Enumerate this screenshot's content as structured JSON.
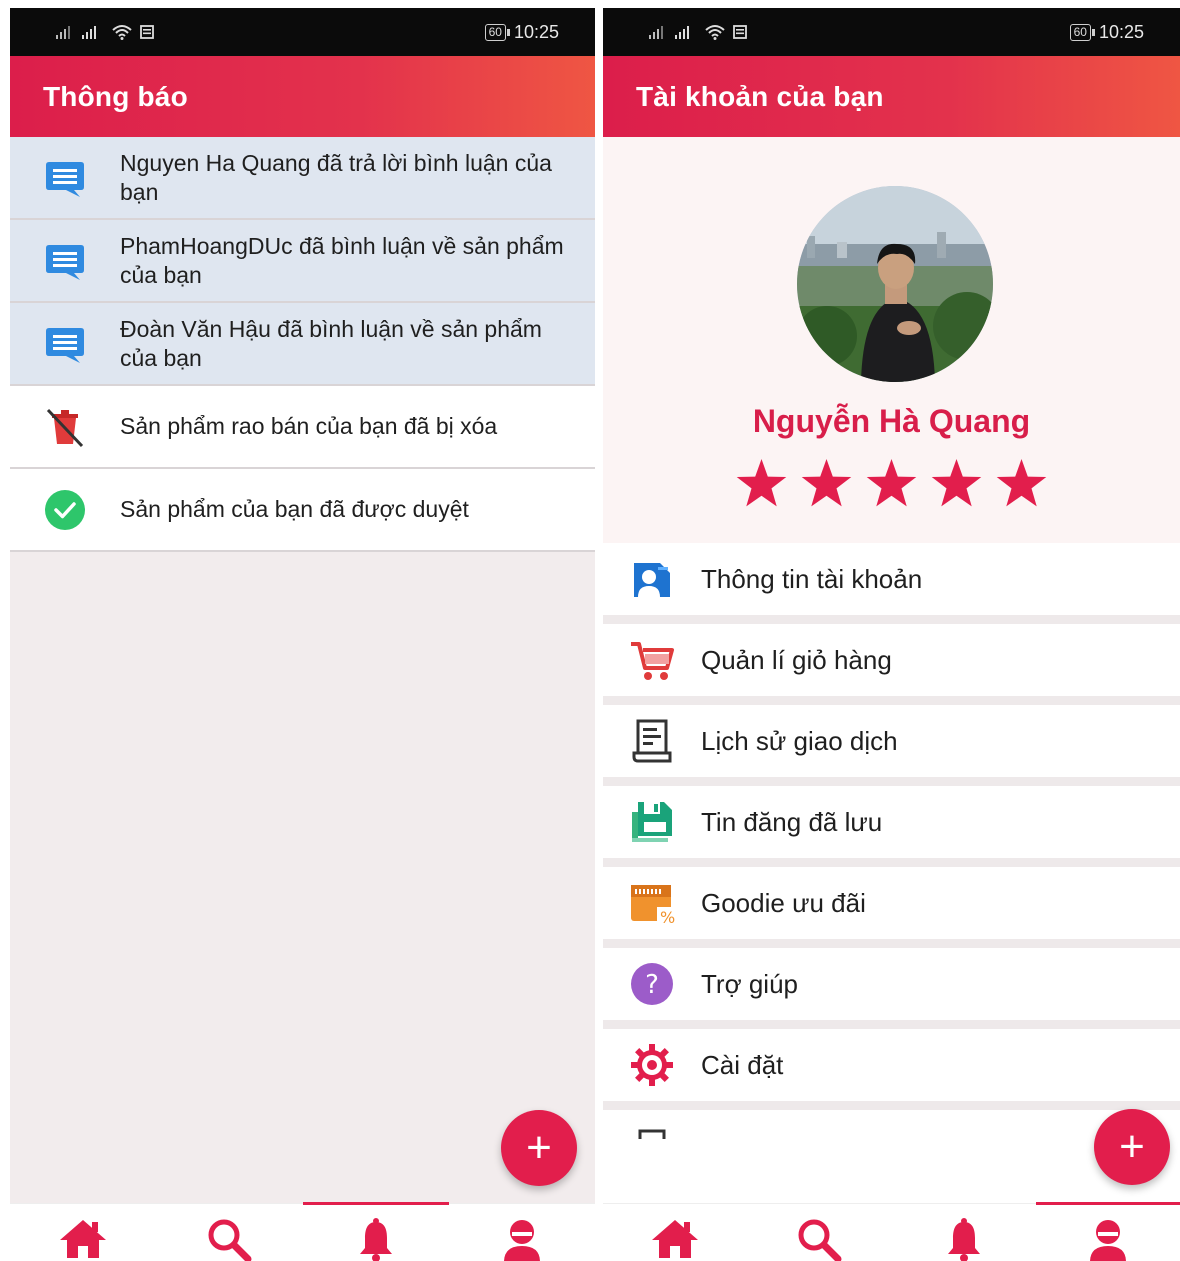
{
  "status_bar": {
    "battery": "60",
    "time": "10:25"
  },
  "left": {
    "title": "Thông báo",
    "notifications": [
      {
        "text": "Nguyen Ha Quang đã trả lời bình luận của bạn",
        "icon": "chat-icon",
        "read": false
      },
      {
        "text": "PhamHoangDUc đã bình luận về sản phẩm của bạn",
        "icon": "chat-icon",
        "read": false
      },
      {
        "text": "Đoàn Văn Hậu đã bình luận về sản phẩm của bạn",
        "icon": "chat-icon",
        "read": false
      },
      {
        "text": "Sản phẩm rao bán của bạn đã bị xóa",
        "icon": "deleted-icon",
        "read": true
      },
      {
        "text": "Sản phẩm của bạn đã được duyệt",
        "icon": "check-icon",
        "read": true
      }
    ],
    "fab": "+",
    "active_tab": "notifications"
  },
  "right": {
    "title": "Tài khoản của bạn",
    "profile": {
      "name": "Nguyễn Hà Quang",
      "rating": 5,
      "max_rating": 5
    },
    "menu": [
      {
        "label": "Thông tin tài khoản",
        "icon": "account-info-icon"
      },
      {
        "label": "Quản lí giỏ hàng",
        "icon": "cart-icon"
      },
      {
        "label": "Lịch sử giao dịch",
        "icon": "receipt-icon"
      },
      {
        "label": "Tin đăng đã lưu",
        "icon": "save-icon"
      },
      {
        "label": "Goodie ưu đãi",
        "icon": "voucher-icon"
      },
      {
        "label": "Trợ giúp",
        "icon": "help-icon"
      },
      {
        "label": "Cài đặt",
        "icon": "settings-icon"
      }
    ],
    "fab": "+",
    "active_tab": "account"
  },
  "colors": {
    "accent": "#e21e4c",
    "gradient_end": "#ef5643",
    "unread_bg": "#dfe6f0"
  }
}
